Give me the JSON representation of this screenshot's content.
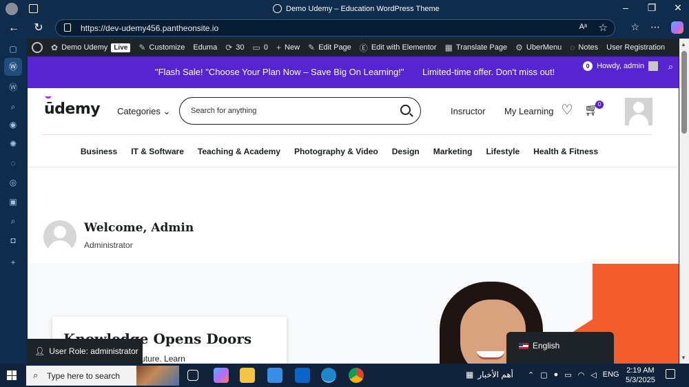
{
  "browser": {
    "window_title": "Demo Udemy – Education WordPress Theme",
    "url": "https://dev-udemy456.pantheonsite.io",
    "read_aloud_label": "Aᵃ"
  },
  "wp_admin_bar": {
    "site_name": "Demo Udemy",
    "live_label": "Live",
    "customize": "Customize",
    "eduma": "Eduma",
    "updates_count": "30",
    "comments_count": "0",
    "new": "New",
    "edit_page": "Edit Page",
    "edit_elementor": "Edit with Elementor",
    "translate": "Translate Page",
    "ubermenu": "UberMenu",
    "notes": "Notes",
    "user_registration": "User Registration"
  },
  "flash": {
    "message": "\"Flash Sale! \"Choose Your Plan Now – Save Big On Learning!\"",
    "offer": "Limited-time offer. Don't miss out!",
    "count": "0",
    "howdy": "Howdy, admin"
  },
  "header": {
    "logo": "ūdemy",
    "categories": "Categories",
    "search_placeholder": "Search for anything",
    "instructor": "Insructor",
    "my_learning": "My Learning",
    "cart_count": "0"
  },
  "category_nav": [
    "Business",
    "IT & Software",
    "Teaching & Academy",
    "Photography & Video",
    "Design",
    "Marketing",
    "Lifestyle",
    "Health & Fitness"
  ],
  "welcome": {
    "title": "Welcome, Admin",
    "role": "Administrator"
  },
  "hero": {
    "title": "Knowledge Opens Doors",
    "text": "possibilities for your future. Learn"
  },
  "user_role_badge": "User Role: administrator",
  "language": "English",
  "taskbar": {
    "search_text": "Type here to search",
    "news": "أهم الأخبار",
    "lang": "ENG",
    "time": "2:19 AM",
    "date": "5/3/2025"
  },
  "colors": {
    "udemy_purple": "#5624d0",
    "orange": "#f45c2d",
    "wp_bar": "#1d2327"
  }
}
